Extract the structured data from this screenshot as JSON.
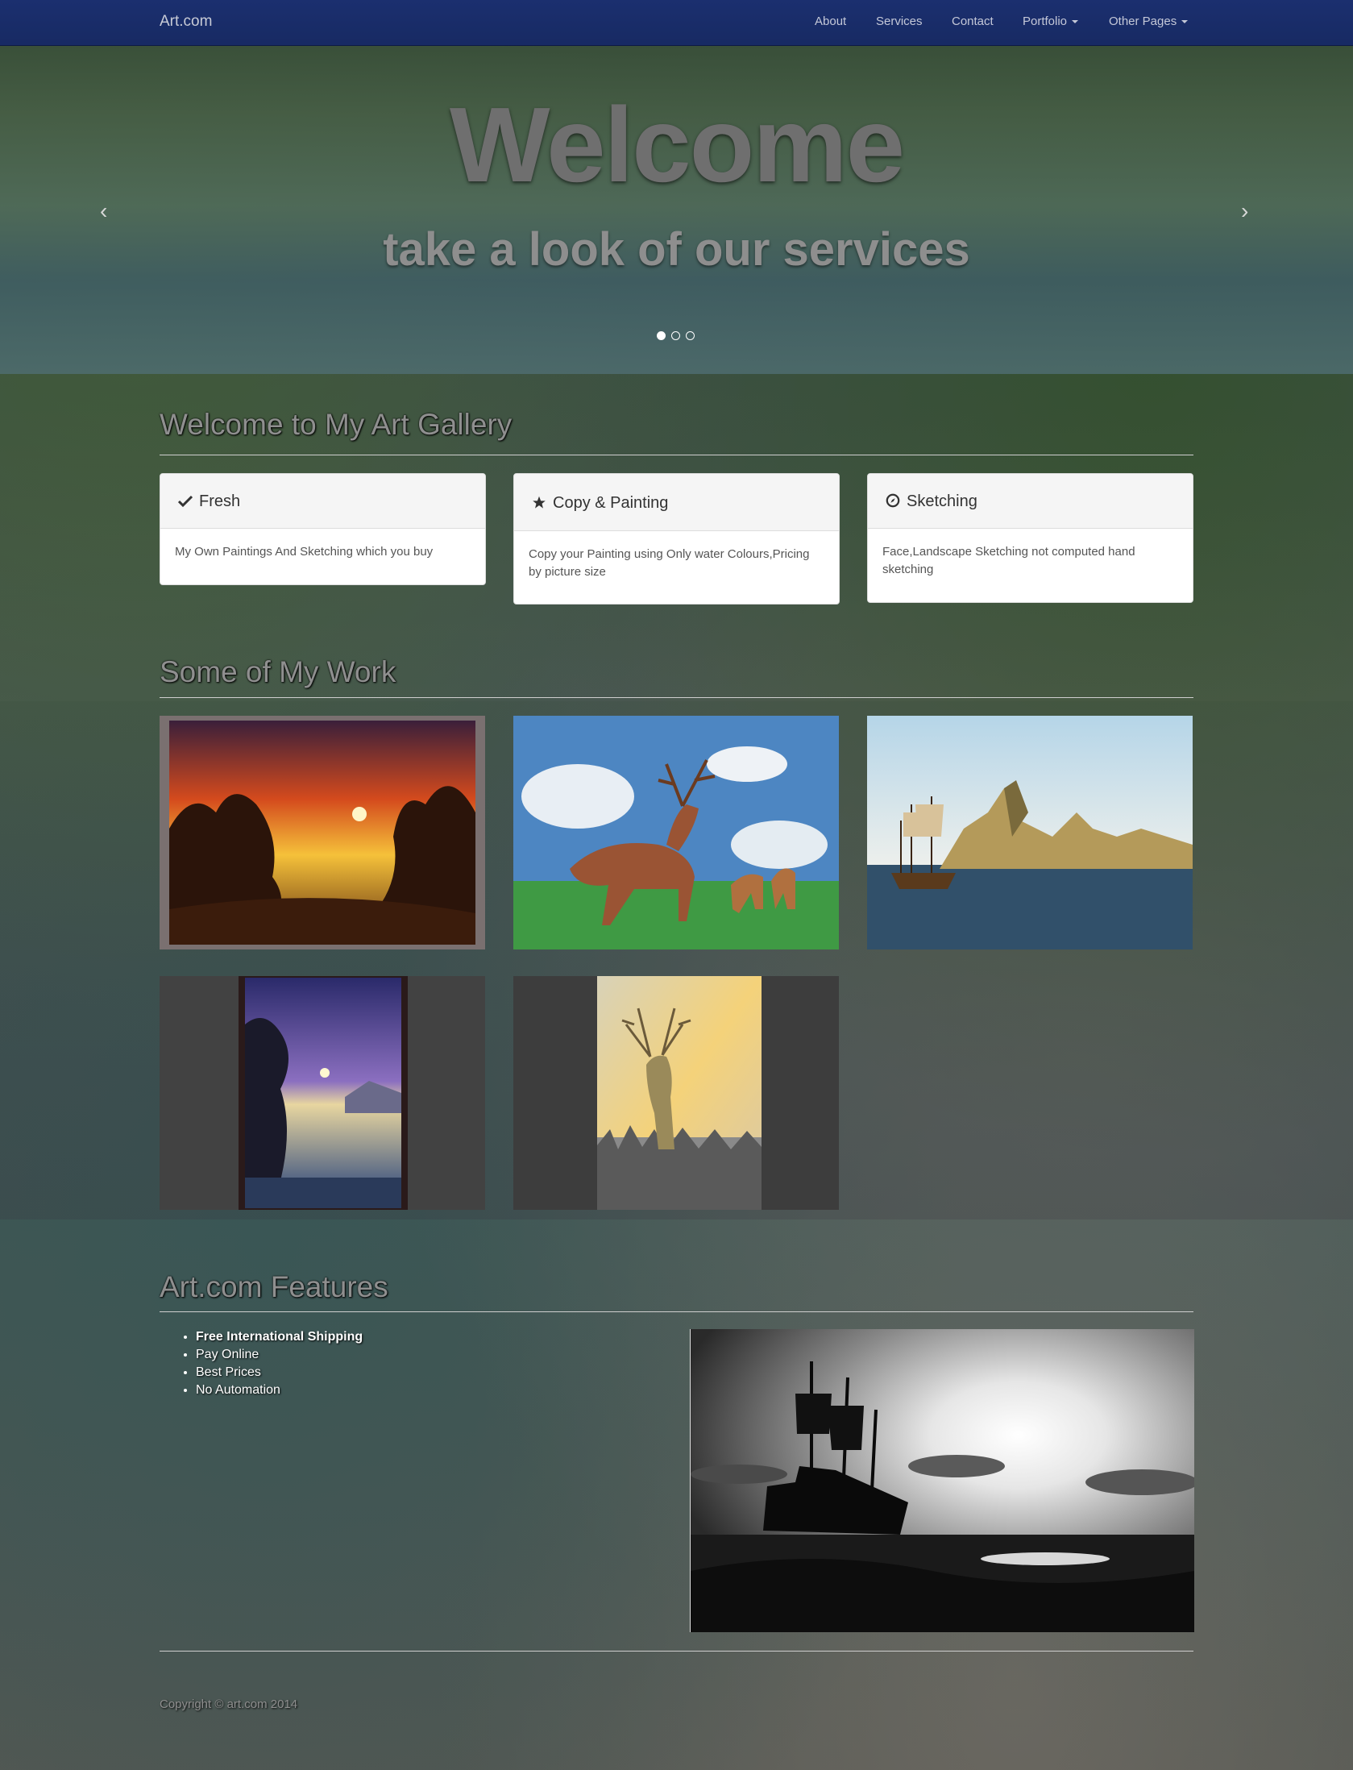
{
  "navbar": {
    "brand": "Art.com",
    "links": [
      "About",
      "Services",
      "Contact"
    ],
    "dropdowns": [
      "Portfolio",
      "Other Pages"
    ]
  },
  "hero": {
    "title": "Welcome",
    "subtitle": "take a look of our services",
    "prev_icon": "‹",
    "next_icon": "›",
    "slide_count": 3,
    "active_slide": 1
  },
  "gallery": {
    "title": "Welcome to My Art Gallery",
    "panels": [
      {
        "icon": "check-icon",
        "heading": "Fresh",
        "body": "My Own Paintings And Sketching which you buy"
      },
      {
        "icon": "star-icon",
        "heading": "Copy & Painting",
        "body": "Copy your Painting using Only water Colours,Pricing by picture size"
      },
      {
        "icon": "compass-icon",
        "heading": "Sketching",
        "body": "Face,Landscape Sketching not computed hand sketching"
      }
    ]
  },
  "work": {
    "title": "Some of My Work",
    "items": [
      "sunset-painting",
      "deer-painting",
      "ship-seascape-painting",
      "night-lake-painting",
      "stag-sketch-painting"
    ]
  },
  "features": {
    "title": "Art.com Features",
    "items": [
      "Free International Shipping",
      "Pay Online",
      "Best Prices",
      "No Automation"
    ],
    "image": "ship-silhouette-photo"
  },
  "footer": {
    "copyright": "Copyright © art.com 2014"
  }
}
